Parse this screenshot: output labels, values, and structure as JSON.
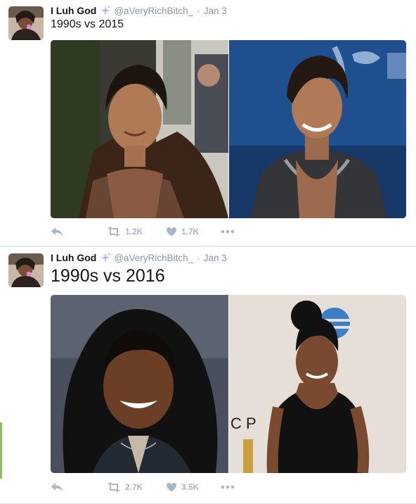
{
  "tweets": [
    {
      "author_name": "I Luh God",
      "handle": "@aVeryRichBitch_",
      "separator": "·",
      "date": "Jan 3",
      "text": "1990s vs 2015",
      "retweets": "1.2K",
      "likes": "1.7K",
      "media": [
        "photo-1990s",
        "photo-2015"
      ]
    },
    {
      "author_name": "I Luh God",
      "handle": "@aVeryRichBitch_",
      "separator": "·",
      "date": "Jan 3",
      "text": "1990s vs 2016",
      "retweets": "2.7K",
      "likes": "3.5K",
      "media": [
        "photo-1990s",
        "photo-2016"
      ]
    }
  ],
  "icons": {
    "reply": "reply-icon",
    "retweet": "retweet-icon",
    "like": "heart-icon",
    "more": "more-dots-icon",
    "sparkle": "sparkle-emoji-icon"
  },
  "colors": {
    "action_gray": "#aab8c2",
    "handle_gray": "#8899a6",
    "background": "#e6ecf0"
  }
}
